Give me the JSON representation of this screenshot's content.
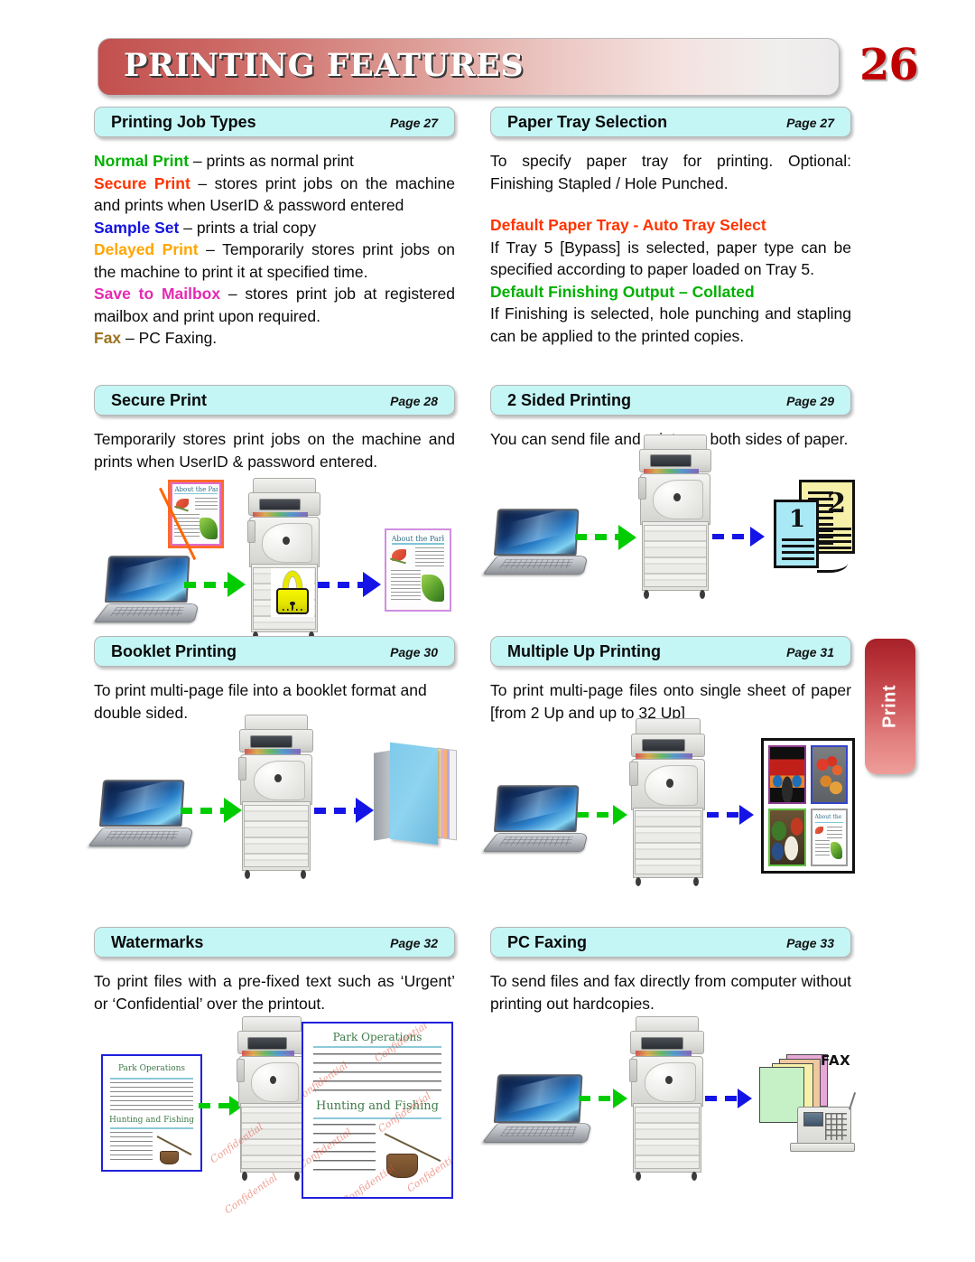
{
  "header": {
    "title": "PRINTING FEATURES",
    "page_number": "26"
  },
  "side_tab": {
    "label": "Print"
  },
  "sections": {
    "printing_job_types": {
      "title": "Printing Job Types",
      "page_ref": "Page 27",
      "items": [
        {
          "keyword": "Normal Print",
          "color": "#00b000",
          "text": " – prints as normal print"
        },
        {
          "keyword": "Secure  Print",
          "color": "#ff3300",
          "text": " –  stores  print  jobs  on  the machine and prints when UserID & password entered"
        },
        {
          "keyword": "Sample Set",
          "color": "#1414e0",
          "text": "  – prints a trial copy"
        },
        {
          "keyword": "Delayed  Print",
          "color": "#ffa500",
          "text": "  –  Temporarily  stores  print jobs  on  the  machine  to  print  it  at  specified time."
        },
        {
          "keyword": "Save  to  Mailbox",
          "color": "#e62ab0",
          "text": "  –  stores  print  job  at registered mailbox and print upon required."
        },
        {
          "keyword": "Fax",
          "color": "#9b7320",
          "text": " – PC Faxing."
        }
      ]
    },
    "paper_tray_selection": {
      "title": "Paper Tray Selection",
      "page_ref": "Page 27",
      "intro": "To specify paper tray for printing. Optional: Finishing Stapled / Hole Punched.",
      "sub1_heading": "Default Paper Tray  - Auto Tray Select",
      "sub1_color": "#ff3300",
      "sub1_text": "If Tray 5 [Bypass] is selected, paper type can be specified according to paper loaded on Tray 5.",
      "sub2_heading": "Default Finishing Output – Collated",
      "sub2_color": "#00b000",
      "sub2_text": "If Finishing is selected, hole punching and stapling can be applied to the printed copies."
    },
    "secure_print": {
      "title": "Secure Print",
      "page_ref": "Page 28",
      "text": "Temporarily stores print jobs on the machine and prints when UserID & password entered.",
      "illustration": {
        "source_doc_title": "About the Park",
        "output_doc_title": "About the Park",
        "lock_icon": "padlock-icon"
      }
    },
    "two_sided_printing": {
      "title": "2 Sided Printing",
      "page_ref": "Page 29",
      "text": "You can send file and prints on both sides of paper.",
      "illustration": {
        "front_page_number": "1",
        "back_page_number": "2"
      }
    },
    "booklet_printing": {
      "title": "Booklet Printing",
      "page_ref": "Page 30",
      "text": "To print multi-page file into a booklet format and double sided."
    },
    "multiple_up_printing": {
      "title": "Multiple Up Printing",
      "page_ref": "Page 31",
      "text": "To print multi-page files onto single sheet of paper [from 2 Up and up to 32 Up]",
      "illustration": {
        "cells": [
          "red-car-photo",
          "fruit-photo",
          "food-photo",
          "about-the-park-document"
        ],
        "doc_title": "About the Park"
      }
    },
    "watermarks": {
      "title": "Watermarks",
      "page_ref": "Page 32",
      "text": "To print files with a pre-fixed text such as ‘Urgent’ or ‘Confidential’ over the printout.",
      "illustration": {
        "doc_heading_1": "Park Operations",
        "doc_heading_2": "Hunting and Fishing",
        "watermark_text": "Confidential"
      }
    },
    "pc_faxing": {
      "title": "PC Faxing",
      "page_ref": "Page 33",
      "text": "To send files and fax directly from computer without printing out hardcopies.",
      "illustration": {
        "fax_label": "FAX"
      }
    }
  }
}
